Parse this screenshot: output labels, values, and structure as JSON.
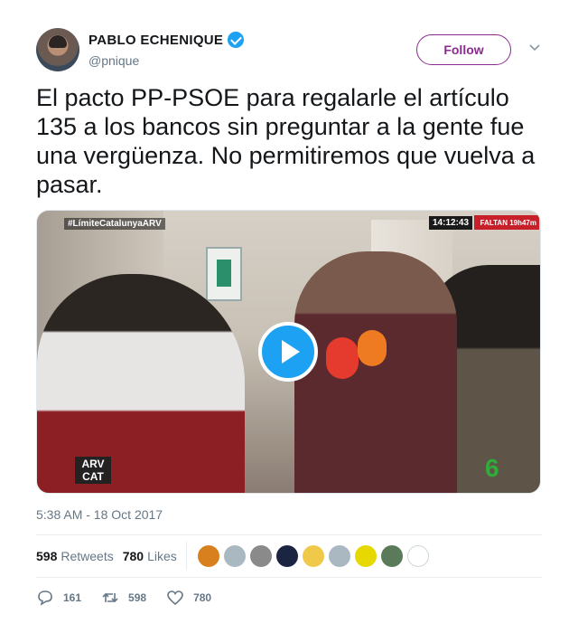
{
  "author": {
    "display_name": "PABLO ECHENIQUE",
    "handle": "@pnique",
    "verified": true,
    "avatar": "avatar"
  },
  "follow_label": "Follow",
  "tweet": {
    "text": "El pacto PP-PSOE para regalarle el artículo 135 a los bancos sin preguntar a la gente fue una vergüenza. No permitiremos que vuelva a pasar.",
    "timestamp": "5:38 AM - 18 Oct 2017"
  },
  "media": {
    "hashtag_overlay": "#LímiteCatalunyaARV",
    "clock_overlay": "14:12:43",
    "countdown_overlay": "FALTAN 19h47m",
    "channel_logo_left": "ARV CAT",
    "channel_logo_right": "6",
    "play_icon": "play-icon"
  },
  "stats": {
    "retweets_count": "598",
    "retweets_label": "Retweets",
    "likes_count": "780",
    "likes_label": "Likes",
    "liker_colors": [
      "#d9801e",
      "#aab8c2",
      "#8a8a8a",
      "#1b2440",
      "#f1c94a",
      "#aab8c2",
      "#e6d800",
      "#5a7a5a",
      "#ffffff"
    ]
  },
  "actions": {
    "replies": "161",
    "retweets": "598",
    "likes": "780"
  },
  "colors": {
    "accent": "#1da1f2",
    "follow_button": "#8b2a8e",
    "muted_text": "#657786"
  }
}
